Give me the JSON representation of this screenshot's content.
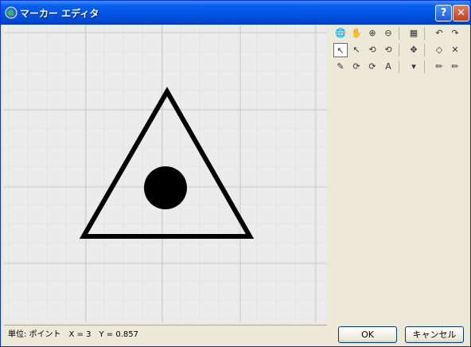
{
  "window": {
    "title": "マーカー エディタ",
    "help_label": "?",
    "close_label": "✕"
  },
  "toolbar": {
    "row1": [
      {
        "name": "globe-icon",
        "glyph": "🌐"
      },
      {
        "name": "hand-pan-icon",
        "glyph": "✋"
      },
      {
        "name": "zoom-in-icon",
        "glyph": "⊕"
      },
      {
        "name": "zoom-out-icon",
        "glyph": "⊖"
      },
      {
        "name": "grid-icon",
        "glyph": "▦"
      },
      {
        "name": "undo-icon",
        "glyph": "↶"
      },
      {
        "name": "redo-icon",
        "glyph": "↷"
      }
    ],
    "row2": [
      {
        "name": "select-arrow-icon",
        "glyph": "↖"
      },
      {
        "name": "direct-select-icon",
        "glyph": "↖"
      },
      {
        "name": "lasso-select-icon",
        "glyph": "⟲"
      },
      {
        "name": "lasso-select-alt-icon",
        "glyph": "⟲"
      },
      {
        "name": "move-icon",
        "glyph": "✥"
      },
      {
        "name": "eraser-icon",
        "glyph": "◇"
      },
      {
        "name": "delete-icon",
        "glyph": "✕"
      }
    ],
    "row3": [
      {
        "name": "pen-add-point-icon",
        "glyph": "✎"
      },
      {
        "name": "rotate-icon",
        "glyph": "⟳"
      },
      {
        "name": "rotate-alt-icon",
        "glyph": "⟳"
      },
      {
        "name": "text-tool-icon",
        "glyph": "A"
      },
      {
        "name": "dropdown-arrow-icon",
        "glyph": "▾"
      },
      {
        "name": "pencil-icon",
        "glyph": "✏"
      },
      {
        "name": "pencil-alt-icon",
        "glyph": "✏"
      }
    ]
  },
  "status": {
    "text": "単位: ポイント　X = 3　Y = 0.857"
  },
  "buttons": {
    "ok_label": "OK",
    "cancel_label": "キャンセル"
  },
  "colors": {
    "canvas_bg": "#ECECEC",
    "grid_major": "#c8c8c8",
    "grid_minor": "#dddddd",
    "shape": "#000000"
  }
}
